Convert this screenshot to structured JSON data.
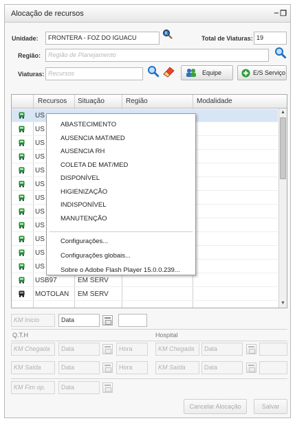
{
  "window": {
    "title": "Alocação de recursos",
    "minimize": "‒",
    "restore": "❐"
  },
  "form": {
    "unidade_label": "Unidade:",
    "unidade_value": "FRONTERA - FOZ DO IGUACU",
    "total_label": "Total de Viaturas:",
    "total_value": "19",
    "regiao_label": "Região:",
    "regiao_placeholder": "Região de Planejamento",
    "viaturas_label": "Viaturas:",
    "viaturas_placeholder": "Recursos",
    "equipe_button": "Equipe",
    "es_servico_button": "E/S Serviço"
  },
  "grid": {
    "columns": [
      "Recursos",
      "Situação",
      "Região",
      "Modalidade"
    ],
    "rows": [
      {
        "recurso": "US",
        "situacao": "",
        "regiao": "",
        "modalidade": "",
        "selected": true,
        "icon": "ambulance-icon"
      },
      {
        "recurso": "US",
        "situacao": "",
        "regiao": "",
        "modalidade": "",
        "selected": false,
        "icon": "ambulance-icon"
      },
      {
        "recurso": "US",
        "situacao": "",
        "regiao": "",
        "modalidade": "",
        "selected": false,
        "icon": "ambulance-icon"
      },
      {
        "recurso": "US",
        "situacao": "",
        "regiao": "",
        "modalidade": "",
        "selected": false,
        "icon": "ambulance-icon"
      },
      {
        "recurso": "US",
        "situacao": "",
        "regiao": "",
        "modalidade": "",
        "selected": false,
        "icon": "ambulance-icon"
      },
      {
        "recurso": "US",
        "situacao": "",
        "regiao": "",
        "modalidade": "",
        "selected": false,
        "icon": "ambulance-icon"
      },
      {
        "recurso": "US",
        "situacao": "",
        "regiao": "",
        "modalidade": "",
        "selected": false,
        "icon": "ambulance-icon"
      },
      {
        "recurso": "US",
        "situacao": "",
        "regiao": "",
        "modalidade": "",
        "selected": false,
        "icon": "ambulance-icon"
      },
      {
        "recurso": "US",
        "situacao": "",
        "regiao": "",
        "modalidade": "",
        "selected": false,
        "icon": "ambulance-icon"
      },
      {
        "recurso": "US",
        "situacao": "",
        "regiao": "",
        "modalidade": "",
        "selected": false,
        "icon": "ambulance-icon"
      },
      {
        "recurso": "US",
        "situacao": "",
        "regiao": "",
        "modalidade": "",
        "selected": false,
        "icon": "ambulance-icon"
      },
      {
        "recurso": "US",
        "situacao": "",
        "regiao": "",
        "modalidade": "",
        "selected": false,
        "icon": "ambulance-icon"
      },
      {
        "recurso": "USB97",
        "situacao": "EM SERV",
        "regiao": "",
        "modalidade": "",
        "selected": false,
        "icon": "ambulance-icon"
      },
      {
        "recurso": "MOTOLAN",
        "situacao": "EM SERV",
        "regiao": "",
        "modalidade": "",
        "selected": false,
        "icon": "motorcycle-icon"
      }
    ]
  },
  "context_menu": {
    "items": [
      "ABASTECIMENTO",
      "AUSENCIA MAT/MED",
      "AUSENCIA RH",
      "COLETA DE MAT/MED",
      "DISPONÍVEL",
      "HIGIENIZAÇÃO",
      "INDISPONÍVEL",
      "MANUTENÇÃO"
    ],
    "system_items": [
      "Configurações...",
      "Configurações globais...",
      "Sobre o Adobe Flash Player 15.0.0.239..."
    ]
  },
  "bottom": {
    "km_inicio_placeholder": "KM Inicio",
    "data_value": "Data",
    "qth_label": "Q.T.H",
    "hospital_label": "Hospital",
    "km_chegada_placeholder": "KM Chegada",
    "km_saida_placeholder": "KM Saída",
    "km_fim_placeholder": "KM Fim op.",
    "data_placeholder": "Data",
    "hora_placeholder": "Hora",
    "cancel_button": "Cancelar Alocação",
    "save_button": "Salvar"
  },
  "colors": {
    "selected_row": "#d7e5f5",
    "ambulance_icon": "#1c8a2a",
    "search_icon": "#1e6ec8"
  }
}
